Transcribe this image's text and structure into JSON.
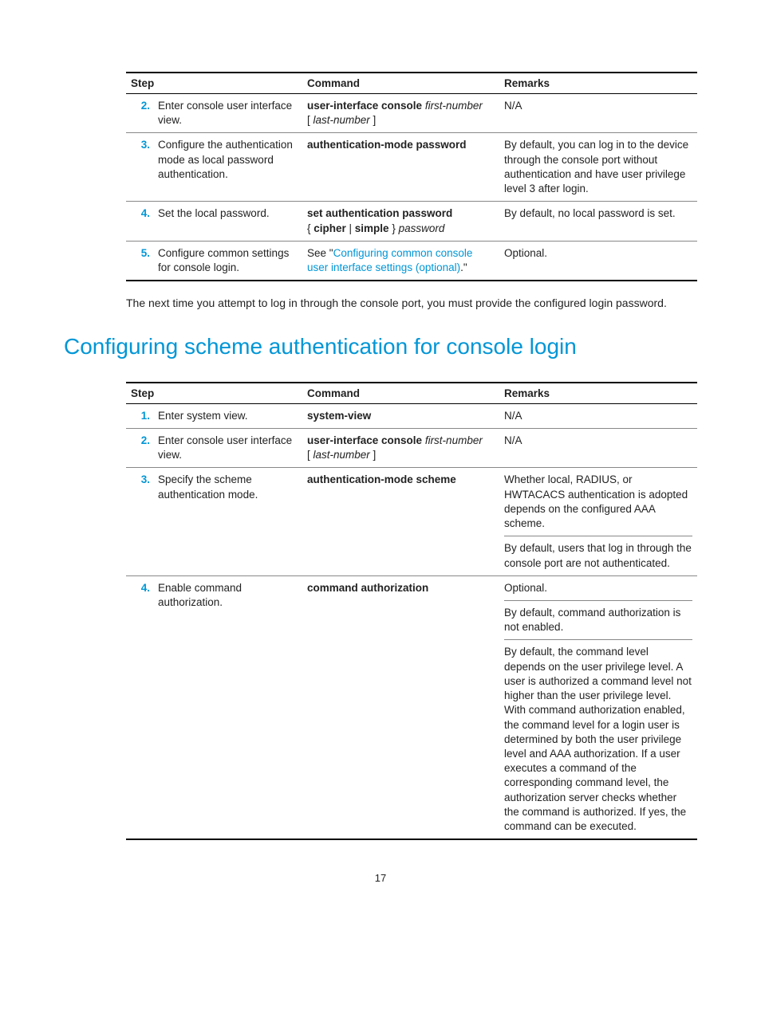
{
  "table1": {
    "headers": {
      "step": "Step",
      "command": "Command",
      "remarks": "Remarks"
    },
    "rows": [
      {
        "num": "2.",
        "action": "Enter console user interface view.",
        "cmd_bold1": "user-interface console ",
        "cmd_italic1": "first-number",
        "cmd_plain1": " [ ",
        "cmd_italic2": "last-number",
        "cmd_plain2": " ]",
        "remarks": "N/A"
      },
      {
        "num": "3.",
        "action": "Configure the authentication mode as local password authentication.",
        "cmd_bold1": "authentication-mode password",
        "remarks": "By default, you can log in to the device through the console port without authentication and have user privilege level 3 after login."
      },
      {
        "num": "4.",
        "action": "Set the local password.",
        "cmd_bold1": "set authentication password ",
        "cmd_plain1": "{ ",
        "cmd_bold2": "cipher",
        "cmd_plain2": " | ",
        "cmd_bold3": "simple",
        "cmd_plain3": " } ",
        "cmd_italic1": "password",
        "remarks": "By default, no local password is set."
      },
      {
        "num": "5.",
        "action": "Configure common settings for console login.",
        "cmd_see": "See \"",
        "cmd_link": "Configuring common console user interface settings (optional)",
        "cmd_after": ".\"",
        "remarks": "Optional."
      }
    ]
  },
  "paragraph1": "The next time you attempt to log in through the console port, you must provide the configured login password.",
  "heading1": "Configuring scheme authentication for console login",
  "table2": {
    "headers": {
      "step": "Step",
      "command": "Command",
      "remarks": "Remarks"
    },
    "rows": [
      {
        "num": "1.",
        "action": "Enter system view.",
        "cmd_bold1": "system-view",
        "remarks": "N/A"
      },
      {
        "num": "2.",
        "action": "Enter console user interface view.",
        "cmd_bold1": "user-interface console ",
        "cmd_italic1": "first-number",
        "cmd_plain1": " [ ",
        "cmd_italic2": "last-number",
        "cmd_plain2": " ]",
        "remarks": "N/A"
      },
      {
        "num": "3.",
        "action": "Specify the scheme authentication mode.",
        "cmd_bold1": "authentication-mode scheme",
        "remarks_a": "Whether local, RADIUS, or HWTACACS authentication is adopted depends on the configured AAA scheme.",
        "remarks_b": "By default, users that log in through the console port are not authenticated."
      },
      {
        "num": "4.",
        "action": "Enable command authorization.",
        "cmd_bold1": "command authorization",
        "remarks_a": "Optional.",
        "remarks_b": "By default, command authorization is not enabled.",
        "remarks_c": "By default, the command level depends on the user privilege level. A user is authorized a command level not higher than the user privilege level. With command authorization enabled, the command level for a login user is determined by both the user privilege level and AAA authorization. If a user executes a command of the corresponding command level, the authorization server checks whether the command is authorized. If yes, the command can be executed."
      }
    ]
  },
  "page_number": "17"
}
